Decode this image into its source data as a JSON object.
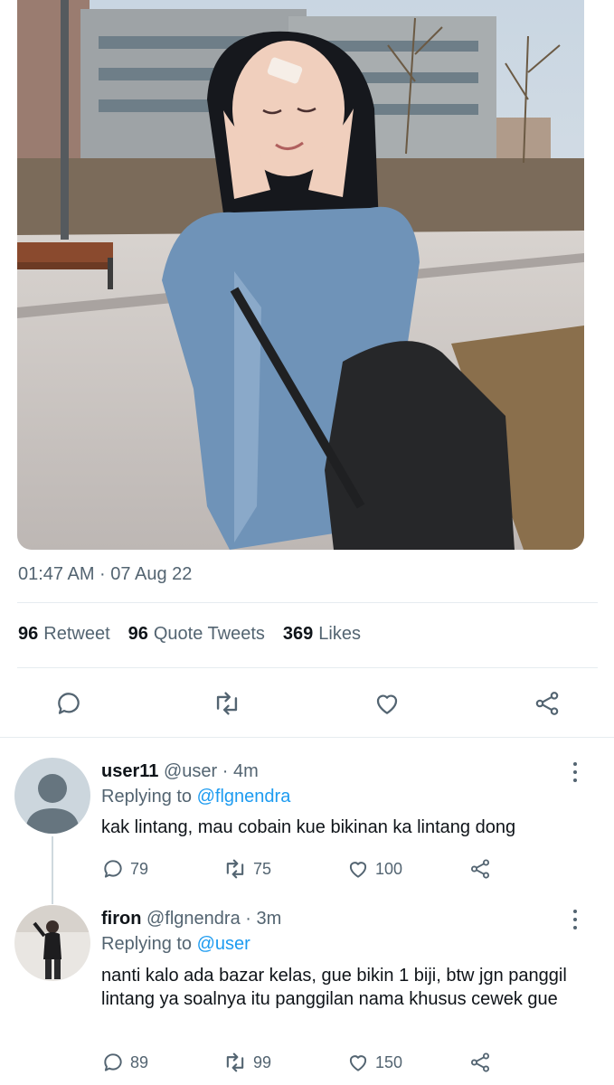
{
  "tweet": {
    "timestamp": "01:47 AM · 07 Aug 22",
    "stats": {
      "retweets": "96",
      "retweets_label": "Retweet",
      "quotes": "96",
      "quotes_label": "Quote Tweets",
      "likes": "369",
      "likes_label": "Likes"
    },
    "action_icons": [
      "reply-icon",
      "retweet-icon",
      "like-icon",
      "share-icon"
    ]
  },
  "replies": [
    {
      "name": "user11",
      "handle": "@user",
      "time": "· 4m",
      "replying_label": "Replying to",
      "replying_to": "@flgnendra",
      "text": "kak lintang, mau cobain kue bikinan ka lintang dong",
      "counts": {
        "replies": "79",
        "retweets": "75",
        "likes": "100"
      }
    },
    {
      "name": "firon",
      "handle": "@flgnendra",
      "time": "· 3m",
      "replying_label": "Replying to",
      "replying_to": "@user",
      "text": "nanti kalo ada bazar kelas, gue bikin 1 biji, btw jgn panggil lintang ya soalnya itu panggilan nama khusus cewek gue",
      "counts": {
        "replies": "89",
        "retweets": "99",
        "likes": "150"
      }
    }
  ],
  "colors": {
    "text": "#0f1419",
    "secondary": "#536471",
    "link": "#1d9bf0",
    "divider": "#e6ecf0"
  }
}
